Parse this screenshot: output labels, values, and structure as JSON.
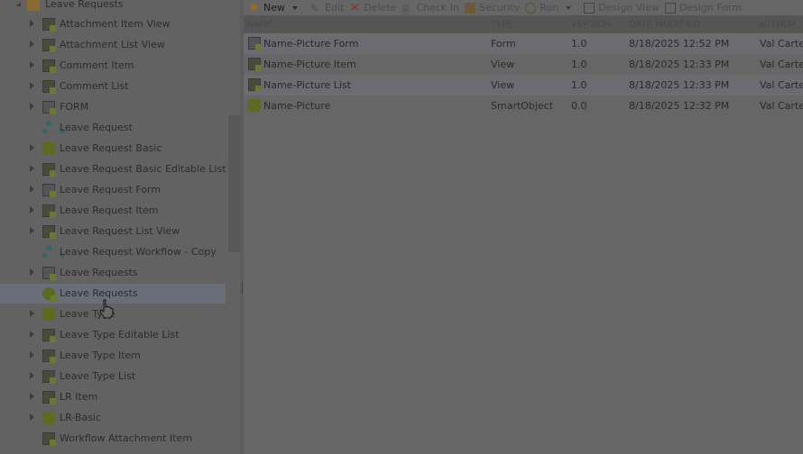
{
  "tree": {
    "root": "Leave Requests",
    "items": [
      {
        "label": "Attachment Item View",
        "icon": "view-icon",
        "expandable": true
      },
      {
        "label": "Attachment List View",
        "icon": "view-icon",
        "expandable": true
      },
      {
        "label": "Comment Item",
        "icon": "view-icon",
        "expandable": true
      },
      {
        "label": "Comment List",
        "icon": "view-icon",
        "expandable": true
      },
      {
        "label": "FORM",
        "icon": "form-icon",
        "expandable": true
      },
      {
        "label": "Leave Request",
        "icon": "workflow-icon",
        "expandable": false
      },
      {
        "label": "Leave Request Basic",
        "icon": "smartobject-icon",
        "expandable": true
      },
      {
        "label": "Leave Request Basic Editable List",
        "icon": "view-icon",
        "expandable": true
      },
      {
        "label": "Leave Request Form",
        "icon": "form-icon",
        "expandable": true
      },
      {
        "label": "Leave Request Item",
        "icon": "view-icon",
        "expandable": true
      },
      {
        "label": "Leave Request List View",
        "icon": "view-icon",
        "expandable": true
      },
      {
        "label": "Leave Request Workflow - Copy",
        "icon": "workflow-icon",
        "expandable": false
      },
      {
        "label": "Leave Requests",
        "icon": "form-icon",
        "expandable": true
      },
      {
        "label": "Leave Requests",
        "icon": "category-icon",
        "expandable": false,
        "selected": true
      },
      {
        "label": "Leave Type",
        "icon": "smartobject-icon",
        "expandable": true
      },
      {
        "label": "Leave Type Editable List",
        "icon": "view-icon",
        "expandable": true
      },
      {
        "label": "Leave Type Item",
        "icon": "view-icon",
        "expandable": true
      },
      {
        "label": "Leave Type List",
        "icon": "view-icon",
        "expandable": true
      },
      {
        "label": "LR Item",
        "icon": "view-icon",
        "expandable": true
      },
      {
        "label": "LR-Basic",
        "icon": "smartobject-icon",
        "expandable": true
      },
      {
        "label": "Workflow Attachment Item",
        "icon": "view-icon",
        "expandable": false
      }
    ]
  },
  "toolbar": {
    "new": "New",
    "edit": "Edit",
    "delete": "Delete",
    "checkin": "Check In",
    "security": "Security",
    "run": "Run",
    "design_view": "Design View",
    "design_form": "Design Form"
  },
  "grid": {
    "headers": {
      "name": "NAME",
      "type": "TYPE",
      "version": "VERSION",
      "date": "DATE MODIFIED",
      "author": "AUTHOR"
    },
    "rows": [
      {
        "name": "Name-Picture Form",
        "type": "Form",
        "version": "1.0",
        "date": "8/18/2025 12:52 PM",
        "author": "Val Carter",
        "icon": "form-icon"
      },
      {
        "name": "Name-Picture Item",
        "type": "View",
        "version": "1.0",
        "date": "8/18/2025 12:33 PM",
        "author": "Val Carter",
        "icon": "view-icon"
      },
      {
        "name": "Name-Picture List",
        "type": "View",
        "version": "1.0",
        "date": "8/18/2025 12:33 PM",
        "author": "Val Carter",
        "icon": "view-icon"
      },
      {
        "name": "Name-Picture",
        "type": "SmartObject",
        "version": "0.0",
        "date": "8/18/2025 12:32 PM",
        "author": "Val Carter",
        "icon": "smartobject-icon"
      }
    ]
  }
}
